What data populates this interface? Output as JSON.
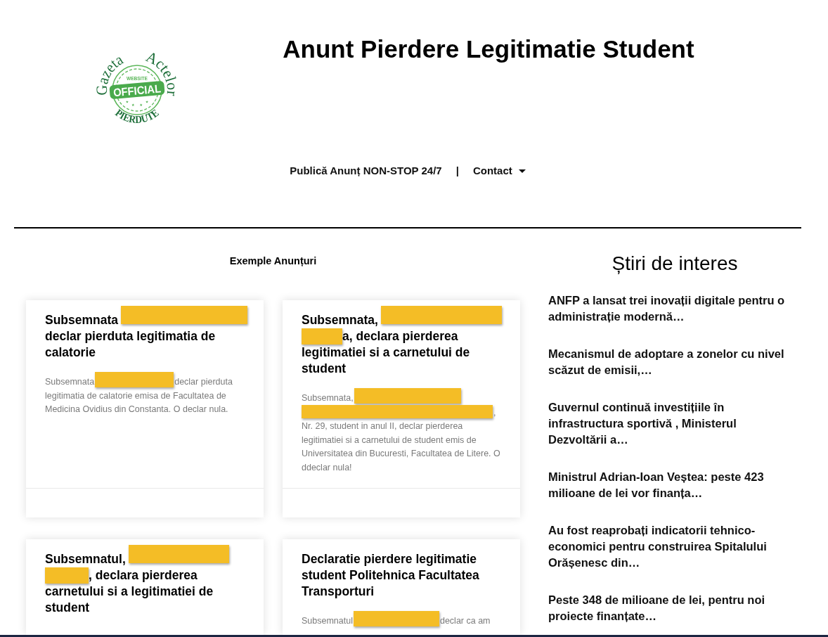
{
  "logo": {
    "title_words": [
      "Gazeta",
      "Actelor"
    ],
    "stamp_label": "WEBSITE",
    "ribbon": "OFFICIAL",
    "subtitle": "PIERDUTE"
  },
  "page_title": "Anunt Pierdere Legitimatie Student",
  "nav": {
    "items": [
      {
        "kind": "link",
        "label": "Publică Anunț NON-STOP 24/7"
      },
      {
        "kind": "separator",
        "label": "|"
      },
      {
        "kind": "dropdown",
        "label": "Contact"
      }
    ]
  },
  "examples": {
    "heading": "Exemple Anunțuri",
    "cards": [
      {
        "title": [
          {
            "kind": "line",
            "parts": [
              {
                "kind": "text",
                "text": "Subsemnata"
              },
              {
                "kind": "redaction"
              }
            ]
          },
          {
            "kind": "text",
            "text": "declar pierduta legitimatia de calatorie"
          }
        ],
        "body": [
          {
            "kind": "line",
            "parts": [
              {
                "kind": "text",
                "text": "Subsemnata"
              },
              {
                "kind": "redaction"
              },
              {
                "kind": "text",
                "text": "declar pierduta"
              }
            ]
          },
          {
            "kind": "text",
            "text": "legitimatia de calatorie emisa de Facultatea de Medicina Ovidius din Constanta. O declar nula."
          }
        ],
        "footer": true
      },
      {
        "title": [
          {
            "kind": "line",
            "parts": [
              {
                "kind": "text",
                "text": "Subsemnata,"
              },
              {
                "kind": "redaction"
              }
            ]
          },
          {
            "kind": "line",
            "parts": [
              {
                "kind": "redaction"
              },
              {
                "kind": "text",
                "text": "a, declara pierderea"
              }
            ]
          },
          {
            "kind": "text",
            "text": "legitimatiei si a carnetului de student"
          }
        ],
        "body": [
          {
            "kind": "line",
            "parts": [
              {
                "kind": "text",
                "text": "Subsemnata,"
              },
              {
                "kind": "redaction"
              }
            ]
          },
          {
            "kind": "line",
            "parts": [
              {
                "kind": "redaction"
              },
              {
                "kind": "text",
                "text": ","
              }
            ]
          },
          {
            "kind": "text",
            "text": "Nr. 29, student in anul II, declar pierderea legitimatiei si a carnetului de student emis de Universitatea din Bucuresti, Facultatea de Litere. O ddeclar nula!"
          }
        ],
        "footer": true
      },
      {
        "title": [
          {
            "kind": "line",
            "parts": [
              {
                "kind": "text",
                "text": "Subsemnatul,"
              },
              {
                "kind": "redaction"
              }
            ]
          },
          {
            "kind": "line",
            "parts": [
              {
                "kind": "redaction"
              },
              {
                "kind": "text",
                "text": ", declara pierderea"
              }
            ]
          },
          {
            "kind": "text",
            "text": "carnetului si a legitimatiei de student"
          }
        ],
        "footer": false
      },
      {
        "title": [
          {
            "kind": "text",
            "text": "Declaratie pierdere legitimatie student Politehnica Facultatea Transporturi"
          }
        ],
        "body": [
          {
            "kind": "line",
            "parts": [
              {
                "kind": "text",
                "text": "Subsemnatul"
              },
              {
                "kind": "redaction"
              },
              {
                "kind": "text",
                "text": "declar ca am"
              }
            ]
          }
        ],
        "footer": false
      }
    ]
  },
  "news": {
    "heading": "Știri de interes",
    "items": [
      "ANFP a lansat trei inovații digitale pentru o administrație modernă…",
      "Mecanismul de adoptare a zonelor cu nivel scăzut de emisii,…",
      "Guvernul continuă investițiile în infrastructura sportivă , Ministerul Dezvoltării a…",
      "Ministrul Adrian-Ioan Veștea: peste 423 milioane de lei vor finanța…",
      "Au fost reaprobați indicatorii tehnico-economici pentru construirea Spitalului Orășenesc din…",
      "Peste 348 de milioane de lei, pentru noi proiecte finanțate…"
    ]
  }
}
